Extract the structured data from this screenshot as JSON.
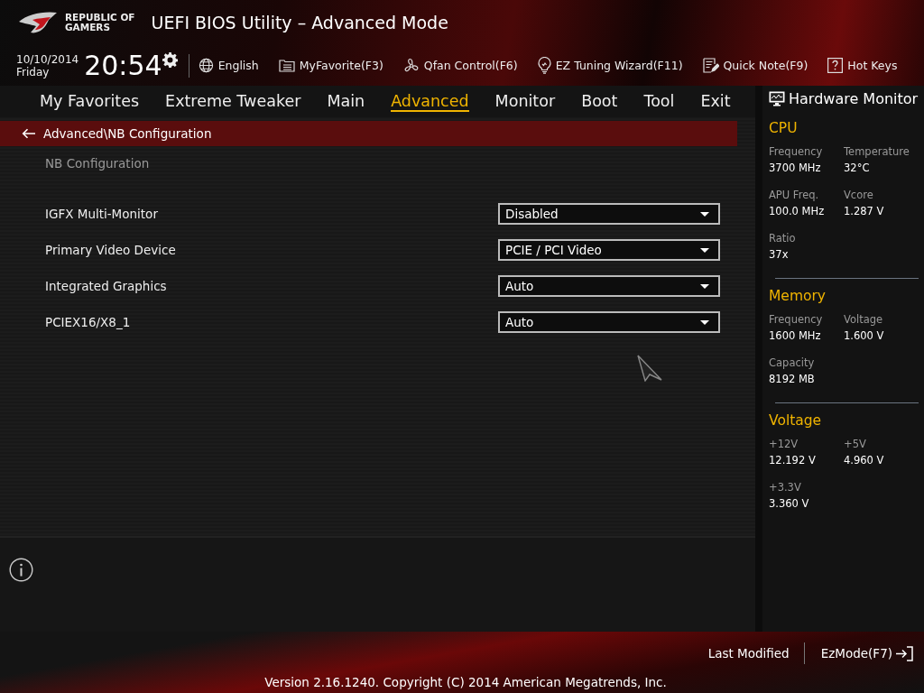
{
  "logo": {
    "line_1": "REPUBLIC OF",
    "line_2": "GAMERS"
  },
  "window": {
    "title": "UEFI BIOS Utility – Advanced Mode"
  },
  "clock": {
    "date": "10/10/2014",
    "day": "Friday",
    "time": "20:54"
  },
  "toolbar": [
    {
      "kind": "language",
      "label": "English"
    },
    {
      "kind": "favorite",
      "label": "MyFavorite(F3)"
    },
    {
      "kind": "fan",
      "label": "Qfan Control(F6)"
    },
    {
      "kind": "wizard",
      "label": "EZ Tuning Wizard(F11)"
    },
    {
      "kind": "note",
      "label": "Quick Note(F9)"
    },
    {
      "kind": "help",
      "label": "Hot Keys"
    }
  ],
  "tabs": [
    {
      "label": "My Favorites",
      "selected": false
    },
    {
      "label": "Extreme Tweaker",
      "selected": false
    },
    {
      "label": "Main",
      "selected": false
    },
    {
      "label": "Advanced",
      "selected": true
    },
    {
      "label": "Monitor",
      "selected": false
    },
    {
      "label": "Boot",
      "selected": false
    },
    {
      "label": "Tool",
      "selected": false
    },
    {
      "label": "Exit",
      "selected": false
    }
  ],
  "breadcrumb": "Advanced\\NB Configuration",
  "section_title": "NB Configuration",
  "settings": [
    {
      "label": "IGFX Multi-Monitor",
      "value": "Disabled"
    },
    {
      "label": "Primary Video Device",
      "value": "PCIE / PCI Video"
    },
    {
      "label": "Integrated Graphics",
      "value": "Auto"
    },
    {
      "label": "PCIEX16/X8_1",
      "value": "Auto"
    }
  ],
  "hardware_monitor": {
    "title": "Hardware Monitor",
    "sections": [
      {
        "title": "CPU",
        "items": [
          {
            "label": "Frequency",
            "value": "3700 MHz"
          },
          {
            "label": "Temperature",
            "value": "32°C"
          },
          {
            "label": "APU Freq.",
            "value": "100.0 MHz"
          },
          {
            "label": "Vcore",
            "value": "1.287 V"
          },
          {
            "label": "Ratio",
            "value": "37x"
          }
        ]
      },
      {
        "title": "Memory",
        "items": [
          {
            "label": "Frequency",
            "value": "1600 MHz"
          },
          {
            "label": "Voltage",
            "value": "1.600 V"
          },
          {
            "label": "Capacity",
            "value": "8192 MB"
          }
        ]
      },
      {
        "title": "Voltage",
        "items": [
          {
            "label": "+12V",
            "value": "12.192 V"
          },
          {
            "label": "+5V",
            "value": "4.960 V"
          },
          {
            "label": "+3.3V",
            "value": "3.360 V"
          }
        ]
      }
    ]
  },
  "footer": {
    "last_modified": "Last Modified",
    "ez_mode": "EzMode(F7)",
    "version": "Version 2.16.1240. Copyright (C) 2014 American Megatrends, Inc."
  }
}
